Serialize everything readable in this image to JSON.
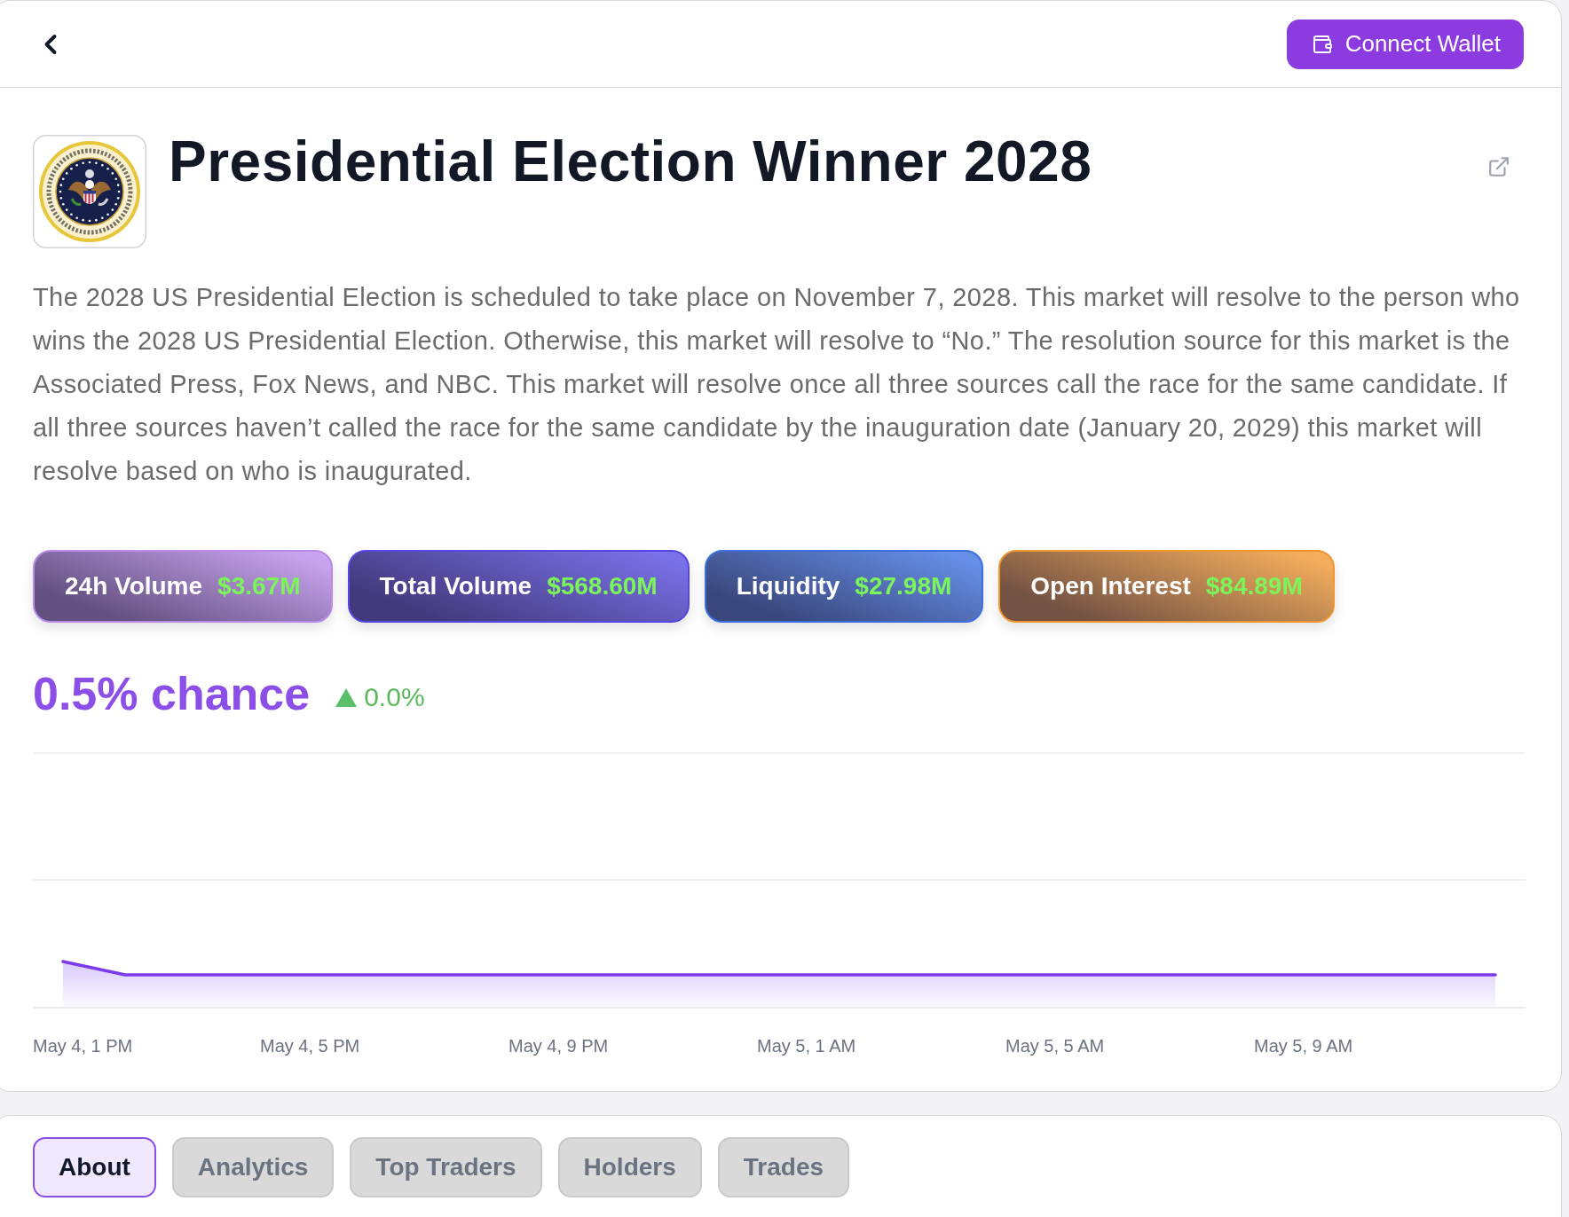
{
  "header": {
    "connect_button": {
      "label": "Connect Wallet"
    }
  },
  "market": {
    "title": "Presidential Election Winner 2028",
    "description": "The 2028 US Presidential Election is scheduled to take place on November 7, 2028. This market will resolve to the person who wins the 2028 US Presidential Election. Otherwise, this market will resolve to “No.” The resolution source for this market is the Associated Press, Fox News, and NBC. This market will resolve once all three sources call the race for the same candidate. If all three sources haven’t called the race for the same candidate by the inauguration date (January 20, 2029) this market will resolve based on who is inaugurated."
  },
  "stats": [
    {
      "label": "24h Volume",
      "value": "$3.67M",
      "color": "#b98ae9"
    },
    {
      "label": "Total Volume",
      "value": "$568.60M",
      "color": "#5548e0"
    },
    {
      "label": "Liquidity",
      "value": "$27.98M",
      "color": "#3b6fe0"
    },
    {
      "label": "Open Interest",
      "value": "$84.89M",
      "color": "#f0962e"
    }
  ],
  "chance": {
    "value": "0.5% chance",
    "change": {
      "rising": true,
      "value": "0.0%"
    }
  },
  "chart": {
    "x_labels": [
      "May 4, 1 PM",
      "May 4, 5 PM",
      "May 4, 9 PM",
      "May 5, 1 AM",
      "May 5, 5 AM",
      "May 5, 9 AM"
    ]
  },
  "tabs": [
    {
      "label": "About",
      "selected": true
    },
    {
      "label": "Analytics",
      "selected": false
    },
    {
      "label": "Top Traders",
      "selected": false
    },
    {
      "label": "Holders",
      "selected": false
    },
    {
      "label": "Trades",
      "selected": false
    }
  ]
}
